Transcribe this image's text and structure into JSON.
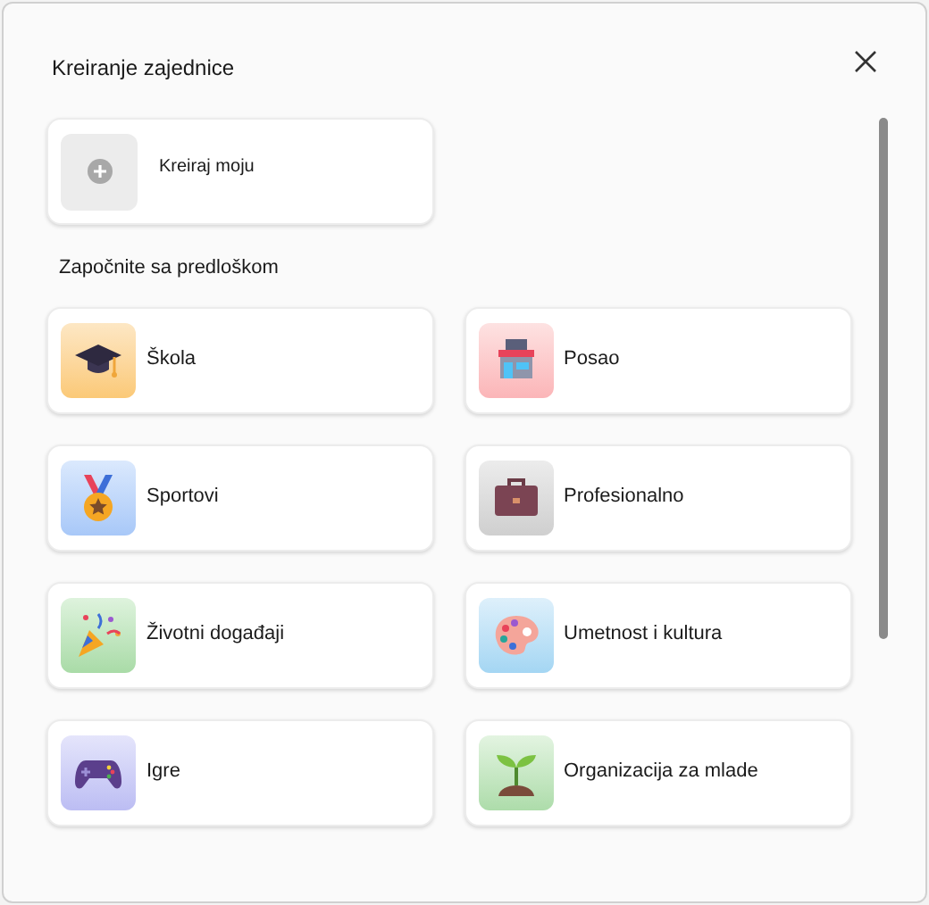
{
  "dialog": {
    "title": "Kreiranje zajednice"
  },
  "create_card": {
    "label": "Kreiraj moju"
  },
  "section_label": "Započnite sa predloškom",
  "templates": [
    {
      "kind": "school",
      "label": "Škola"
    },
    {
      "kind": "business",
      "label": "Posao"
    },
    {
      "kind": "sports",
      "label": "Sportovi"
    },
    {
      "kind": "professional",
      "label": "Profesionalno"
    },
    {
      "kind": "events",
      "label": "Životni događaji"
    },
    {
      "kind": "art",
      "label": "Umetnost i kultura"
    },
    {
      "kind": "games",
      "label": "Igre"
    },
    {
      "kind": "youth",
      "label": "Organizacija za mlade"
    }
  ]
}
